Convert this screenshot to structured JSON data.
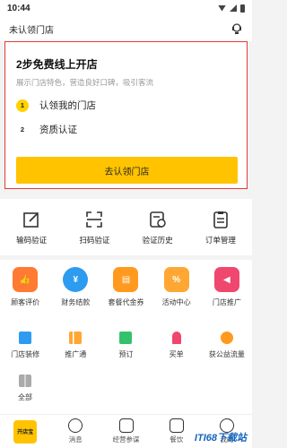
{
  "status": {
    "time": "10:44"
  },
  "header": {
    "title": "未认领门店"
  },
  "claim_card": {
    "title": "2步免费线上开店",
    "subtitle": "展示门店特色，营造良好口碑，吸引客流",
    "steps": [
      {
        "num": "1",
        "label": "认领我的门店"
      },
      {
        "num": "2",
        "label": "资质认证"
      }
    ],
    "cta_label": "去认领门店",
    "border_color": "#e53935",
    "accent_color": "#ffc300"
  },
  "tools": [
    {
      "icon": "edit-icon",
      "label": "输码验证"
    },
    {
      "icon": "scan-icon",
      "label": "扫码验证"
    },
    {
      "icon": "history-icon",
      "label": "验证历史"
    },
    {
      "icon": "order-icon",
      "label": "订单管理"
    }
  ],
  "services_row1": [
    {
      "icon": "thumbs-up-icon",
      "label": "顾客评价",
      "color": "#ff7a33"
    },
    {
      "icon": "yen-icon",
      "label": "财务结款",
      "color": "#2d9cf0"
    },
    {
      "icon": "voucher-icon",
      "label": "套餐代金券",
      "color": "#ff9a1f"
    },
    {
      "icon": "percent-icon",
      "label": "活动中心",
      "color": "#ffa733"
    },
    {
      "icon": "megaphone-icon",
      "label": "门店推广",
      "color": "#f0476e"
    }
  ],
  "services_row2": [
    {
      "icon": "store-icon",
      "label": "门店装修",
      "color": "#2d9cf0"
    },
    {
      "icon": "bar-chart-icon",
      "label": "推广通",
      "color": "#ffa733"
    },
    {
      "icon": "sofa-icon",
      "label": "预订",
      "color": "#33c26b"
    },
    {
      "icon": "mic-icon",
      "label": "买单",
      "color": "#f0476e"
    },
    {
      "icon": "bag-icon",
      "label": "获公益流量",
      "color": "#ff9a1f"
    }
  ],
  "all_label": "全部",
  "tabbar": [
    {
      "label": "开店宝",
      "icon": "app-logo-icon"
    },
    {
      "label": "消息",
      "icon": "message-icon"
    },
    {
      "label": "经营参谋",
      "icon": "chart-icon"
    },
    {
      "label": "餐饮",
      "icon": "dining-icon"
    },
    {
      "label": "我的",
      "icon": "profile-icon"
    }
  ],
  "watermark": "ITI68下载站"
}
